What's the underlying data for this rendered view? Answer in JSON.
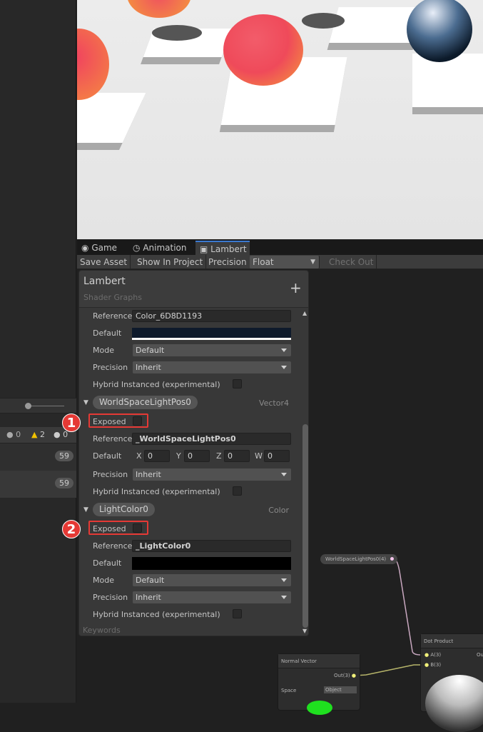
{
  "tabs": [
    {
      "label": "Game",
      "icon": "gamepad-icon"
    },
    {
      "label": "Animation",
      "icon": "clock-icon"
    },
    {
      "label": "Lambert",
      "icon": "shadergraph-icon"
    }
  ],
  "toolbar": {
    "save_asset": "Save Asset",
    "show_in_project": "Show In Project",
    "precision_label": "Precision",
    "precision_value": "Float",
    "check_out": "Check Out"
  },
  "blackboard": {
    "title": "Lambert",
    "subtitle": "Shader Graphs",
    "add": "+",
    "keywords": "Keywords",
    "color_prop": {
      "reference_label": "Reference",
      "reference": "Color_6D8D1193",
      "default_label": "Default",
      "default_color": "#0e1a2b",
      "mode_label": "Mode",
      "mode": "Default",
      "precision_label": "Precision",
      "precision": "Inherit",
      "hybrid_label": "Hybrid Instanced (experimental)"
    },
    "light_pos": {
      "name": "WorldSpaceLightPos0",
      "type": "Vector4",
      "exposed_label": "Exposed",
      "reference_label": "Reference",
      "reference": "_WorldSpaceLightPos0",
      "default_label": "Default",
      "x_label": "X",
      "x": "0",
      "y_label": "Y",
      "y": "0",
      "z_label": "Z",
      "z": "0",
      "w_label": "W",
      "w": "0",
      "precision_label": "Precision",
      "precision": "Inherit",
      "hybrid_label": "Hybrid Instanced (experimental)"
    },
    "light_color": {
      "name": "LightColor0",
      "type": "Color",
      "exposed_label": "Exposed",
      "reference_label": "Reference",
      "reference": "_LightColor0",
      "default_label": "Default",
      "default_color": "#000000",
      "mode_label": "Mode",
      "mode": "Default",
      "precision_label": "Precision",
      "precision": "Inherit",
      "hybrid_label": "Hybrid Instanced (experimental)"
    }
  },
  "console": {
    "info_count": "0",
    "warn_count": "2",
    "error_count": "0",
    "rows": [
      "59",
      "59"
    ]
  },
  "callouts": [
    "1",
    "2"
  ],
  "graph": {
    "prop_node": "WorldSpaceLightPos0(4)",
    "dot": {
      "title": "Dot Product",
      "a": "A(3)",
      "b": "B(3)",
      "out": "Out"
    },
    "normal": {
      "title": "Normal Vector",
      "out": "Out(3)",
      "space_label": "Space",
      "space": "Object"
    }
  }
}
